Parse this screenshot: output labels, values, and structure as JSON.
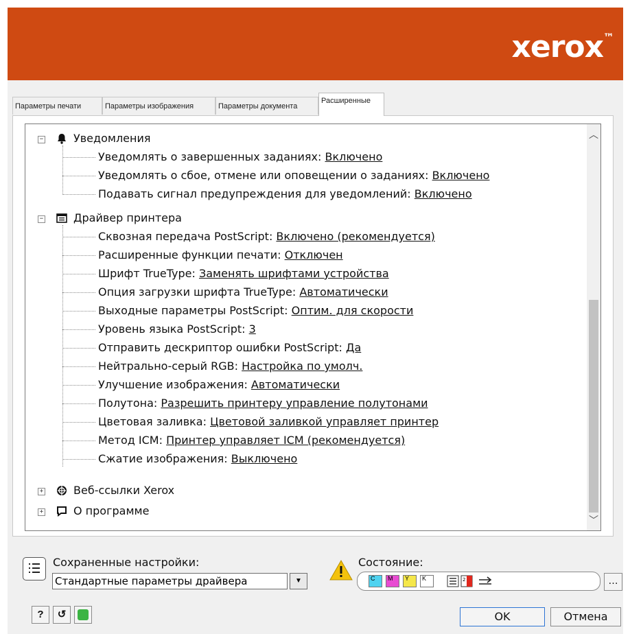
{
  "header": {
    "logo": "xerox",
    "logo_suffix": "™",
    "brand_color": "#cf4a12"
  },
  "tabs": [
    {
      "label": "Параметры печати"
    },
    {
      "label": "Параметры изображения"
    },
    {
      "label": "Параметры документа"
    },
    {
      "label": "Расширенные",
      "active": true
    }
  ],
  "tree": {
    "notifications": {
      "label": "Уведомления",
      "icon": "bell-icon",
      "items": [
        {
          "label": "Уведомлять о завершенных заданиях:",
          "value": "Включено"
        },
        {
          "label": "Уведомлять о сбое, отмене или оповещении о заданиях:",
          "value": "Включено"
        },
        {
          "label": "Подавать сигнал предупреждения для уведомлений:",
          "value": "Включено"
        }
      ]
    },
    "driver": {
      "label": "Драйвер принтера",
      "icon": "driver-window-icon",
      "items": [
        {
          "label": "Сквозная передача PostScript:",
          "value": "Включено (рекомендуется)"
        },
        {
          "label": "Расширенные функции печати:",
          "value": "Отключен"
        },
        {
          "label": "Шрифт TrueType:",
          "value": "Заменять шрифтами устройства"
        },
        {
          "label": "Опция загрузки шрифта TrueType:",
          "value": "Автоматически"
        },
        {
          "label": "Выходные параметры PostScript:",
          "value": "Оптим. для скорости"
        },
        {
          "label": "Уровень языка PostScript:",
          "value": "3"
        },
        {
          "label": "Отправить дескриптор ошибки PostScript:",
          "value": "Да"
        },
        {
          "label": "Нейтрально-серый RGB:",
          "value": "Настройка по умолч."
        },
        {
          "label": "Улучшение изображения:",
          "value": "Автоматически"
        },
        {
          "label": "Полутона:",
          "value": "Разрешить принтеру управление полутонами"
        },
        {
          "label": "Цветовая заливка:",
          "value": "Цветовой заливкой управляет принтер"
        },
        {
          "label": "Метод ICM:",
          "value": "Принтер управляет ICM (рекомендуется)"
        },
        {
          "label": "Сжатие изображения:",
          "value": "Выключено"
        }
      ]
    },
    "weblinks": {
      "label": "Веб-ссылки Xerox",
      "icon": "web-globe-icon"
    },
    "about": {
      "label": "О программе",
      "icon": "speech-bubble-icon"
    }
  },
  "saved_settings": {
    "label": "Сохраненные настройки:",
    "value": "Стандартные параметры драйвера"
  },
  "status": {
    "label": "Состояние:",
    "inks": [
      {
        "letter": "C",
        "color": "#4fd3f0"
      },
      {
        "letter": "M",
        "color": "#e84bd2"
      },
      {
        "letter": "Y",
        "color": "#f5e74a"
      },
      {
        "letter": "K",
        "color": "#ffffff"
      }
    ],
    "more_label": "…"
  },
  "buttons": {
    "help": "?",
    "reset": "↺",
    "ok": "OK",
    "cancel": "Отмена"
  },
  "colors": {
    "warning": "#f4c20d",
    "green": "#3cb443"
  }
}
